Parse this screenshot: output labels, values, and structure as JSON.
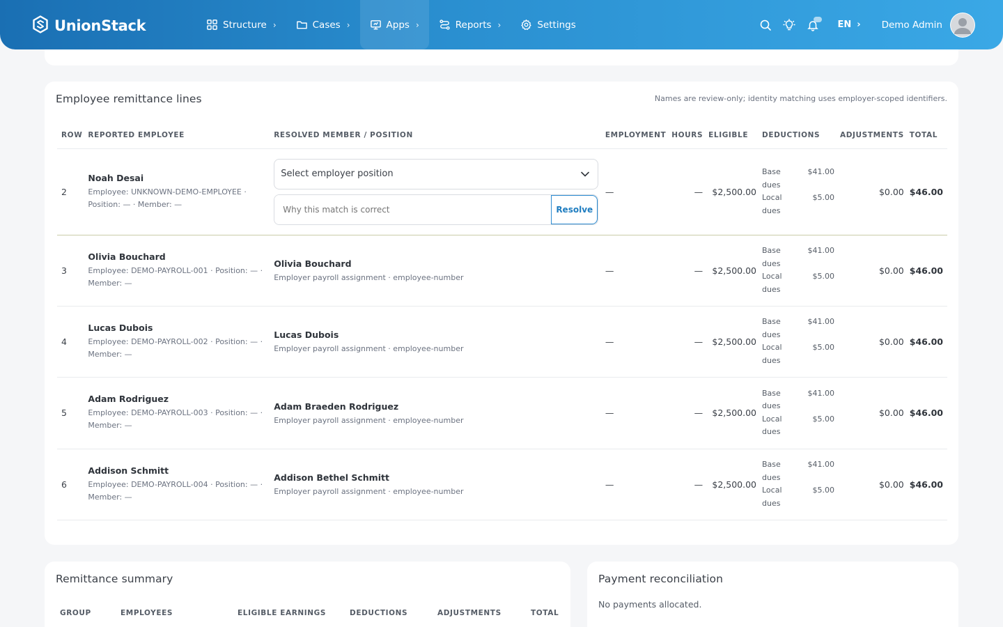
{
  "brand": {
    "name": "UnionStack"
  },
  "nav": {
    "items": [
      {
        "label": "Structure",
        "icon": "grid-icon"
      },
      {
        "label": "Cases",
        "icon": "folder-icon"
      },
      {
        "label": "Apps",
        "icon": "monitor-icon"
      },
      {
        "label": "Reports",
        "icon": "route-icon"
      },
      {
        "label": "Settings",
        "icon": "gear-icon"
      }
    ],
    "active": "Apps"
  },
  "header": {
    "language": "EN",
    "user_name": "Demo Admin"
  },
  "lines_card": {
    "title": "Employee remittance lines",
    "note": "Names are review-only; identity matching uses employer-scoped identifiers.",
    "columns": [
      "ROW",
      "REPORTED EMPLOYEE",
      "RESOLVED MEMBER / POSITION",
      "EMPLOYMENT",
      "HOURS",
      "ELIGIBLE",
      "DEDUCTIONS",
      "ADJUSTMENTS",
      "TOTAL"
    ],
    "unresolved": {
      "row": "2",
      "name": "Noah Desai",
      "meta": "Employee: UNKNOWN-DEMO-EMPLOYEE · Position: — · Member: —",
      "select_placeholder": "Select employer position",
      "reason_placeholder": "Why this match is correct",
      "resolve_label": "Resolve",
      "employment": "—",
      "hours": "—",
      "eligible": "$2,500.00",
      "deductions": [
        {
          "label": "Base dues",
          "amount": "$41.00"
        },
        {
          "label": "Local dues",
          "amount": "$5.00"
        }
      ],
      "adjustments": "$0.00",
      "total": "$46.00"
    },
    "rows": [
      {
        "row": "3",
        "name": "Olivia Bouchard",
        "meta": "Employee: DEMO-PAYROLL-001 · Position: — · Member: —",
        "resolved_name": "Olivia Bouchard",
        "resolved_meta": "Employer payroll assignment · employee-number",
        "employment": "—",
        "hours": "—",
        "eligible": "$2,500.00",
        "deductions": [
          {
            "label": "Base dues",
            "amount": "$41.00"
          },
          {
            "label": "Local dues",
            "amount": "$5.00"
          }
        ],
        "adjustments": "$0.00",
        "total": "$46.00"
      },
      {
        "row": "4",
        "name": "Lucas Dubois",
        "meta": "Employee: DEMO-PAYROLL-002 · Position: — · Member: —",
        "resolved_name": "Lucas Dubois",
        "resolved_meta": "Employer payroll assignment · employee-number",
        "employment": "—",
        "hours": "—",
        "eligible": "$2,500.00",
        "deductions": [
          {
            "label": "Base dues",
            "amount": "$41.00"
          },
          {
            "label": "Local dues",
            "amount": "$5.00"
          }
        ],
        "adjustments": "$0.00",
        "total": "$46.00"
      },
      {
        "row": "5",
        "name": "Adam Rodriguez",
        "meta": "Employee: DEMO-PAYROLL-003 · Position: — · Member: —",
        "resolved_name": "Adam Braeden Rodriguez",
        "resolved_meta": "Employer payroll assignment · employee-number",
        "employment": "—",
        "hours": "—",
        "eligible": "$2,500.00",
        "deductions": [
          {
            "label": "Base dues",
            "amount": "$41.00"
          },
          {
            "label": "Local dues",
            "amount": "$5.00"
          }
        ],
        "adjustments": "$0.00",
        "total": "$46.00"
      },
      {
        "row": "6",
        "name": "Addison Schmitt",
        "meta": "Employee: DEMO-PAYROLL-004 · Position: — · Member: —",
        "resolved_name": "Addison Bethel Schmitt",
        "resolved_meta": "Employer payroll assignment · employee-number",
        "employment": "—",
        "hours": "—",
        "eligible": "$2,500.00",
        "deductions": [
          {
            "label": "Base dues",
            "amount": "$41.00"
          },
          {
            "label": "Local dues",
            "amount": "$5.00"
          }
        ],
        "adjustments": "$0.00",
        "total": "$46.00"
      }
    ]
  },
  "summary_card": {
    "title": "Remittance summary",
    "columns": [
      "GROUP",
      "EMPLOYEES",
      "ELIGIBLE EARNINGS",
      "DEDUCTIONS",
      "ADJUSTMENTS",
      "TOTAL"
    ]
  },
  "payment_card": {
    "title": "Payment reconciliation",
    "note": "No payments allocated."
  },
  "colors": {
    "accent": "#1f7dc0",
    "header_gradient_start": "#1a6fb3",
    "header_gradient_end": "#3aa8e6"
  }
}
